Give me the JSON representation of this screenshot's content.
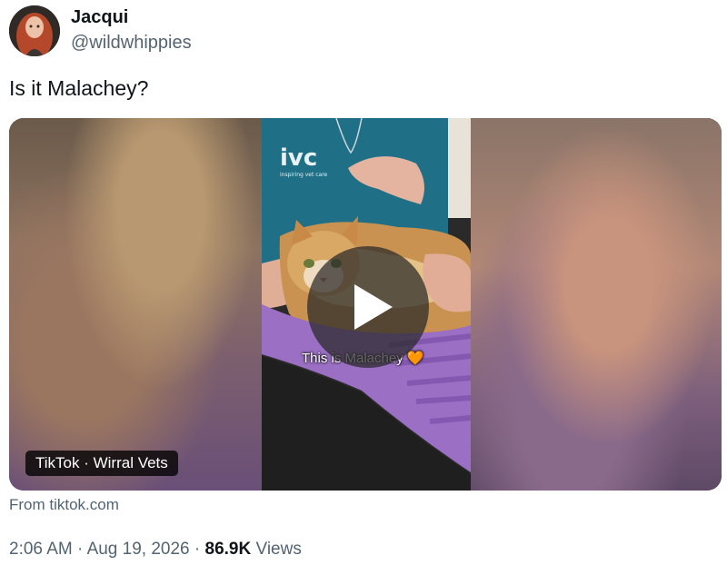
{
  "author": {
    "display_name": "Jacqui",
    "handle": "@wildwhippies",
    "avatar_icon": "user-avatar-icon"
  },
  "tweet": {
    "text": "Is it Malachey?"
  },
  "media": {
    "type": "video",
    "overlay_caption": "This is Malachey 🧡",
    "source_badge": "TikTok · Wirral Vets",
    "shirt_logo": "ivc",
    "shirt_tagline": "inspiring vet care",
    "play_icon": "play-icon"
  },
  "link": {
    "from_text": "From tiktok.com"
  },
  "meta": {
    "time": "2:06 AM",
    "separator": "·",
    "date": "Aug 19, 2026",
    "views_count": "86.9K",
    "views_label": "Views"
  }
}
